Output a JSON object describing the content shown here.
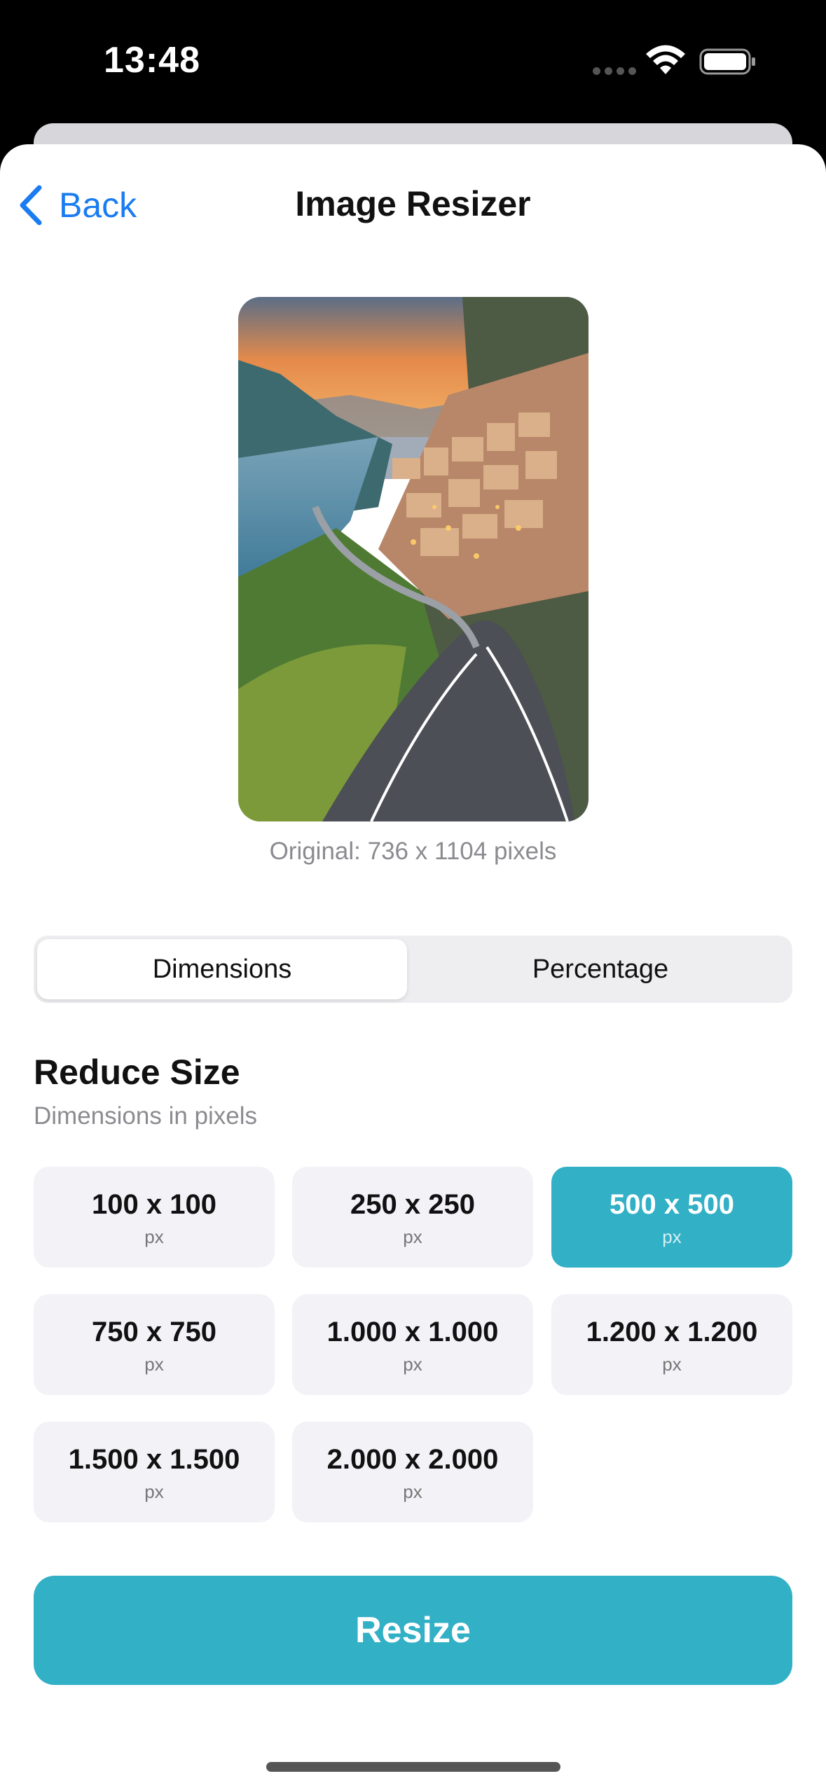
{
  "status_bar": {
    "time": "13:48"
  },
  "nav": {
    "back_label": "Back",
    "title": "Image Resizer"
  },
  "preview": {
    "original_info": "Original: 736 x 1104 pixels"
  },
  "tabs": [
    {
      "label": "Dimensions",
      "selected": true
    },
    {
      "label": "Percentage",
      "selected": false
    }
  ],
  "section": {
    "title": "Reduce Size",
    "subtitle": "Dimensions in pixels"
  },
  "size_options": [
    {
      "value": "100 x 100",
      "unit": "px",
      "selected": false
    },
    {
      "value": "250 x 250",
      "unit": "px",
      "selected": false
    },
    {
      "value": "500 x 500",
      "unit": "px",
      "selected": true
    },
    {
      "value": "750 x 750",
      "unit": "px",
      "selected": false
    },
    {
      "value": "1.000 x 1.000",
      "unit": "px",
      "selected": false
    },
    {
      "value": "1.200 x 1.200",
      "unit": "px",
      "selected": false
    },
    {
      "value": "1.500 x 1.500",
      "unit": "px",
      "selected": false
    },
    {
      "value": "2.000 x 2.000",
      "unit": "px",
      "selected": false
    }
  ],
  "actions": {
    "resize_label": "Resize"
  },
  "colors": {
    "accent": "#31b0c6",
    "link": "#1a7cf0",
    "option_bg": "#f2f2f7"
  },
  "icons": [
    "wifi-icon",
    "battery-icon",
    "chevron-left-icon"
  ]
}
